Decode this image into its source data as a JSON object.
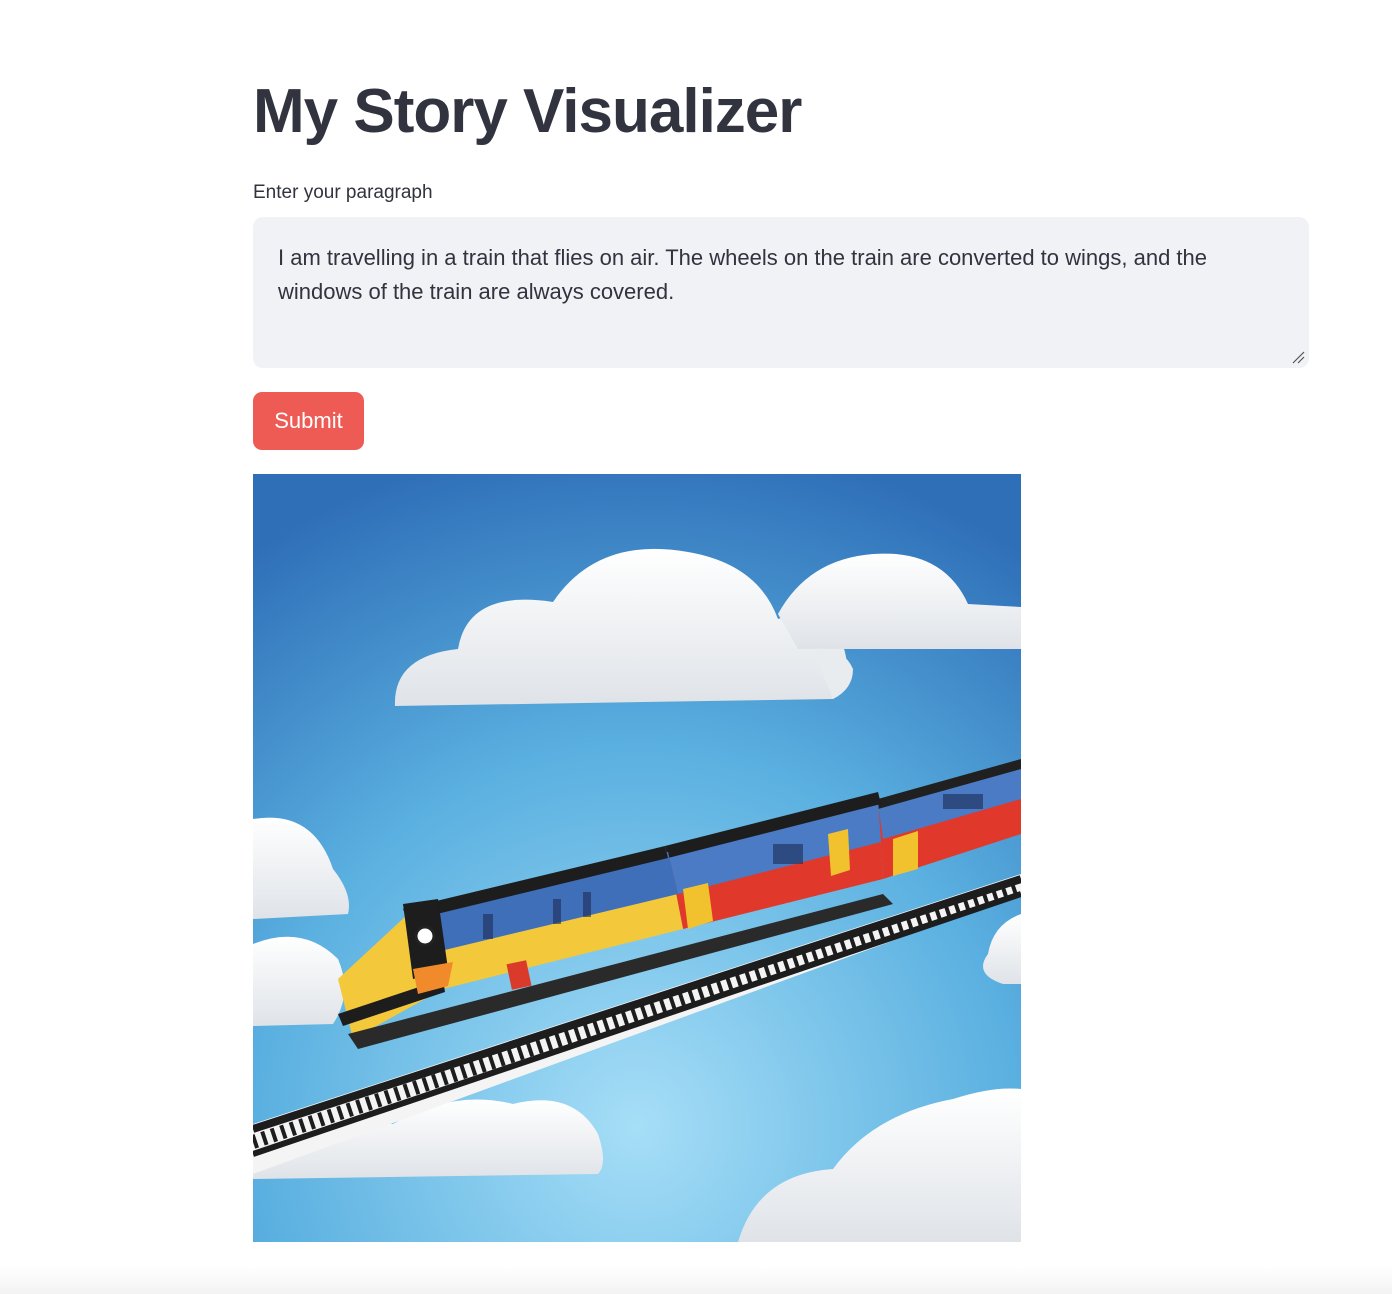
{
  "app": {
    "title": "My Story Visualizer"
  },
  "form": {
    "label": "Enter your paragraph",
    "paragraph_value": "I am travelling in a train that flies on air. The wheels on the train are converted to wings, and the windows of the train are always covered.",
    "submit_label": "Submit"
  },
  "output": {
    "image_description_icon": "generated-story-image"
  },
  "colors": {
    "accent": "#ee5b55",
    "text": "#31333f",
    "input_bg": "#f0f2f6"
  }
}
